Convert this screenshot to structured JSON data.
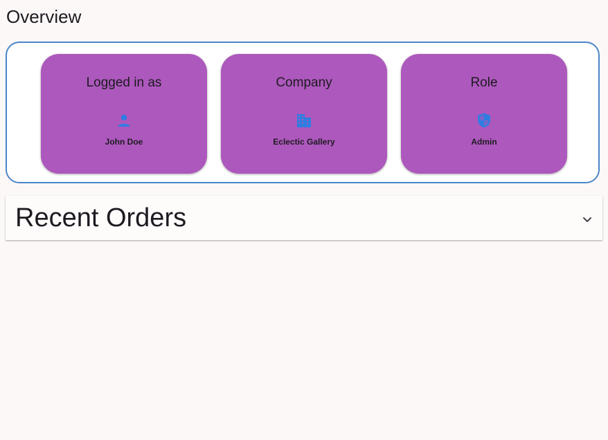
{
  "page": {
    "title": "Overview"
  },
  "overview": {
    "cards": [
      {
        "label": "Logged in as",
        "value": "John Doe",
        "icon": "person-icon"
      },
      {
        "label": "Company",
        "value": "Eclectic Gallery",
        "icon": "building-icon"
      },
      {
        "label": "Role",
        "value": "Admin",
        "icon": "shield-icon"
      }
    ]
  },
  "recent_orders": {
    "title": "Recent Orders",
    "toggle_icon": "chevron-down-icon"
  },
  "colors": {
    "card_background": "#ad58bd",
    "panel_border": "#4a86c8",
    "icon_blue": "#2f7de1",
    "page_background": "#fdf8f8"
  }
}
